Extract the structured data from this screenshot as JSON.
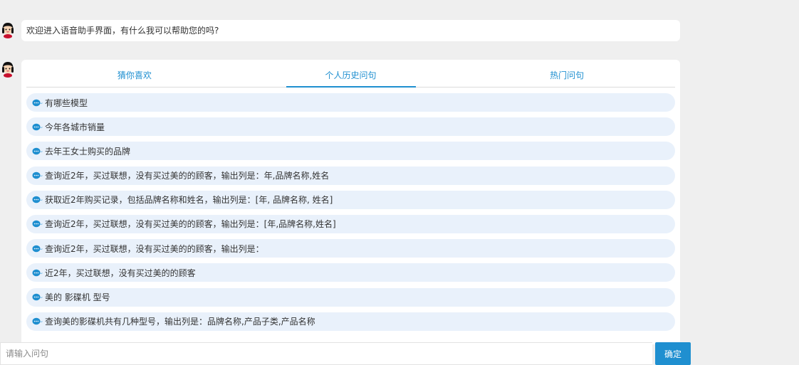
{
  "welcome": {
    "text": "欢迎进入语音助手界面，有什么我可以帮助您的吗?"
  },
  "tabs": [
    {
      "label": "猜你喜欢",
      "active": false
    },
    {
      "label": "个人历史问句",
      "active": true
    },
    {
      "label": "热门问句",
      "active": false
    }
  ],
  "history": [
    "有哪些模型",
    "今年各城市销量",
    "去年王女士购买的品牌",
    "查询近2年，买过联想，没有买过美的的顾客，输出列是：年,品牌名称,姓名",
    "获取近2年购买记录，包括品牌名称和姓名，输出列是：[年, 品牌名称, 姓名]",
    "查询近2年，买过联想，没有买过美的的顾客，输出列是：[年,品牌名称,姓名]",
    "查询近2年，买过联想，没有买过美的的顾客，输出列是：",
    "近2年，买过联想，没有买过美的的顾客",
    "美的 影碟机 型号",
    "查询美的影碟机共有几种型号，输出列是：品牌名称,产品子类,产品名称"
  ],
  "input": {
    "placeholder": "请输入问句",
    "value": ""
  },
  "confirm_label": "确定",
  "colors": {
    "accent": "#1f8fd0",
    "item_bg": "#e9f1fb",
    "page_bg": "#efefef"
  },
  "icons": {
    "avatar": "girl-avatar-icon",
    "item": "chat-bubble-icon"
  }
}
